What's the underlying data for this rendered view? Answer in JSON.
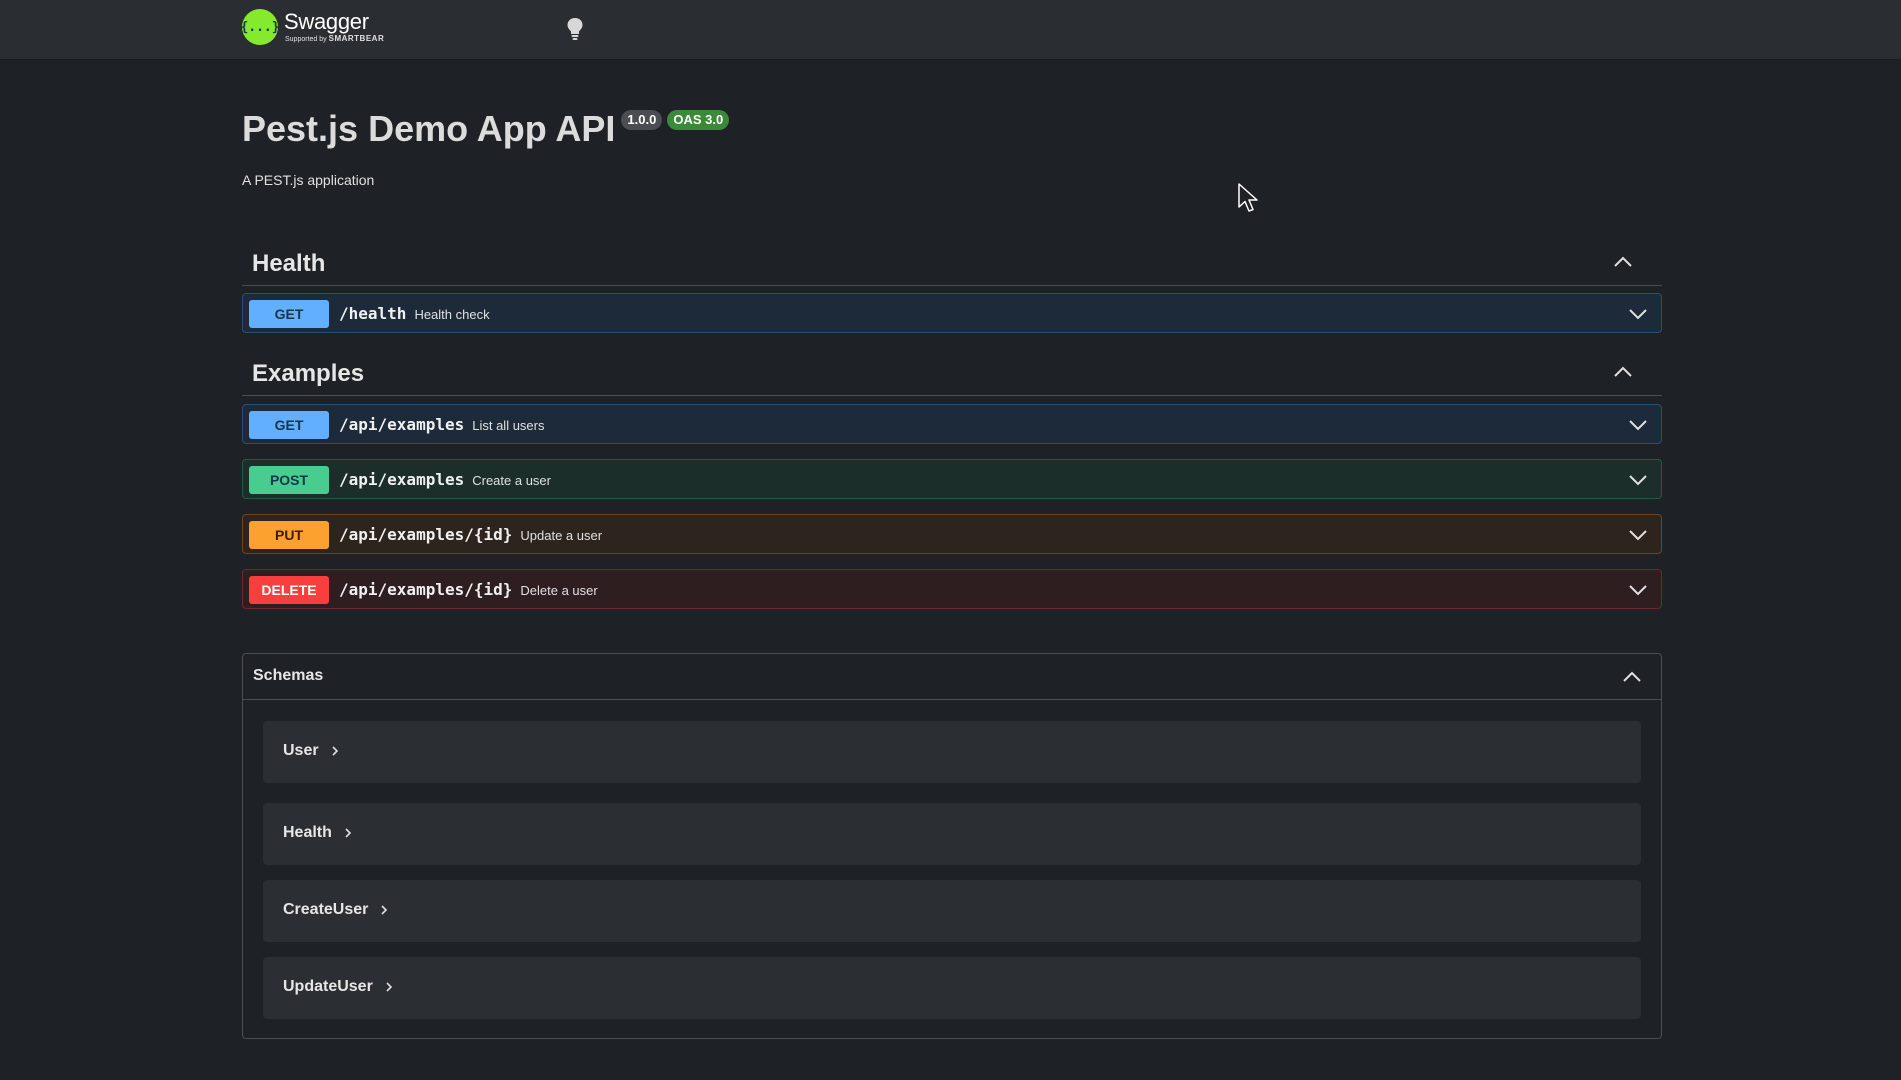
{
  "header": {
    "brand": "Swagger",
    "brand_sub_prefix": "Supported by",
    "brand_sub_company": "SMARTBEAR",
    "logo_glyph": "{...}"
  },
  "info": {
    "title": "Pest.js Demo App API",
    "version": "1.0.0",
    "oas": "OAS 3.0",
    "description": "A PEST.js application"
  },
  "tags": [
    {
      "name": "Health",
      "operations": [
        {
          "method": "GET",
          "path": "/health",
          "summary": "Health check"
        }
      ]
    },
    {
      "name": "Examples",
      "operations": [
        {
          "method": "GET",
          "path": "/api/examples",
          "summary": "List all users"
        },
        {
          "method": "POST",
          "path": "/api/examples",
          "summary": "Create a user"
        },
        {
          "method": "PUT",
          "path": "/api/examples/{id}",
          "summary": "Update a user"
        },
        {
          "method": "DELETE",
          "path": "/api/examples/{id}",
          "summary": "Delete a user"
        }
      ]
    }
  ],
  "schemas": {
    "title": "Schemas",
    "items": [
      "User",
      "Health",
      "CreateUser",
      "UpdateUser"
    ]
  },
  "colors": {
    "get": "#61affe",
    "post": "#49cc90",
    "put": "#fca130",
    "delete": "#f93e3e",
    "logo": "#85ea2d"
  },
  "icons": {
    "theme_toggle": "lightbulb-icon",
    "collapse": "chevron-up-icon",
    "expand": "chevron-down-icon",
    "schema_expand": "chevron-right-icon"
  }
}
